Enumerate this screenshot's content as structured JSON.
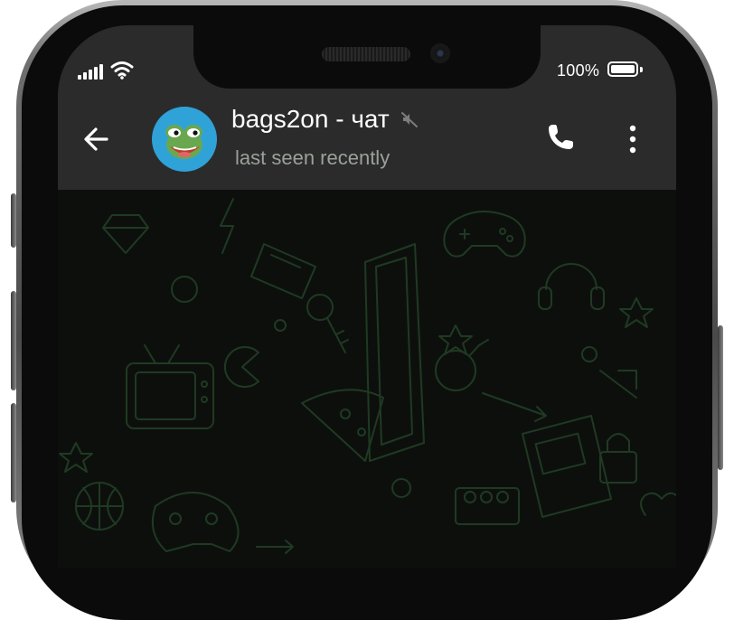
{
  "status_bar": {
    "battery_percent": "100%",
    "icons": [
      "signal-icon",
      "wifi-icon",
      "battery-icon"
    ]
  },
  "header": {
    "back_icon": "arrow-left-icon",
    "contact_name": "bags2on - чат",
    "muted_icon": "muted-speaker-icon",
    "status": "last seen recently",
    "call_icon": "phone-icon",
    "menu_icon": "more-vertical-icon"
  },
  "colors": {
    "bar_background": "#2b2b2b",
    "chat_background": "#0d0f0d",
    "doodle_stroke": "#1f3a22",
    "avatar_background": "#2fa2d8",
    "subtitle_text": "#9aa19a"
  }
}
